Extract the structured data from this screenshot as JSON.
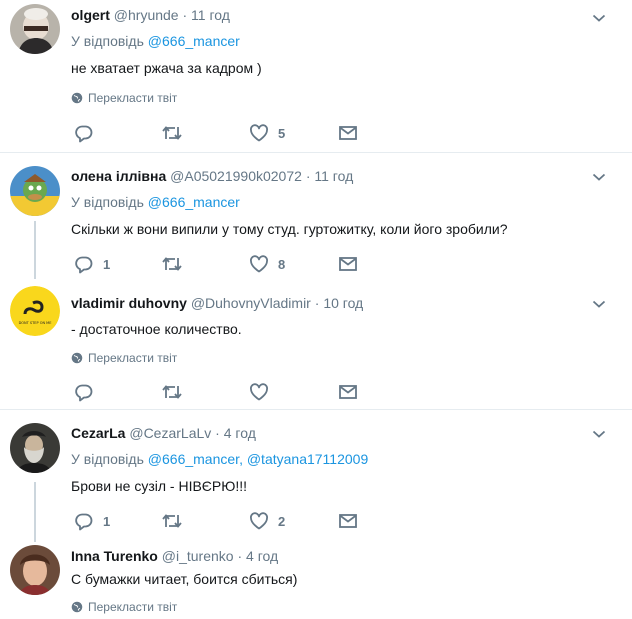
{
  "tweets": [
    {
      "name": "olgert",
      "handle": "@hryunde",
      "sep": "·",
      "time": "11 год",
      "reply_prefix": "У відповідь",
      "reply_to": "@666_mancer",
      "reply_to2": "",
      "text": "не хватает ржача за кадром )",
      "translate": "Перекласти твіт",
      "replies": "",
      "retweets": "",
      "likes": "5"
    },
    {
      "name": "олена іллівна",
      "handle": "@A05021990k02072",
      "sep": "·",
      "time": "11 год",
      "reply_prefix": "У відповідь",
      "reply_to": "@666_mancer",
      "reply_to2": "",
      "text": "Скільки ж вони випили у тому студ. гуртожитку, коли його зробили?",
      "translate": "",
      "replies": "1",
      "retweets": "",
      "likes": "8"
    },
    {
      "name": "vladimir duhovny",
      "handle": "@DuhovnyVladimir",
      "sep": "·",
      "time": "10 год",
      "reply_prefix": "",
      "reply_to": "",
      "reply_to2": "",
      "text": "- достаточное количество.",
      "translate": "Перекласти твіт",
      "replies": "",
      "retweets": "",
      "likes": ""
    },
    {
      "name": "CezarLa",
      "handle": "@CezarLaLv",
      "sep": "·",
      "time": "4 год",
      "reply_prefix": "У відповідь",
      "reply_to": "@666_mancer",
      "reply_to2": "@tatyana17112009",
      "text": "Брови не сузіл - НІВЄРЮ!!!",
      "translate": "",
      "replies": "1",
      "retweets": "",
      "likes": "2"
    },
    {
      "name": "Inna Turenko",
      "handle": "@i_turenko",
      "sep": "·",
      "time": "4 год",
      "reply_prefix": "",
      "reply_to": "",
      "reply_to2": "",
      "text": "С бумажки читает, боится сбиться)",
      "translate": "Перекласти твіт",
      "replies": "",
      "retweets": "",
      "likes": ""
    }
  ],
  "avatar3_text": "DONT STEP ON ME",
  "colors": {
    "accent": "#1b95e0",
    "muted": "#657786",
    "border": "#e6ecf0",
    "thread": "#ccd6dd"
  },
  "icons": [
    "reply-icon",
    "retweet-icon",
    "like-icon",
    "message-icon",
    "globe-icon",
    "chevron-down-icon"
  ]
}
